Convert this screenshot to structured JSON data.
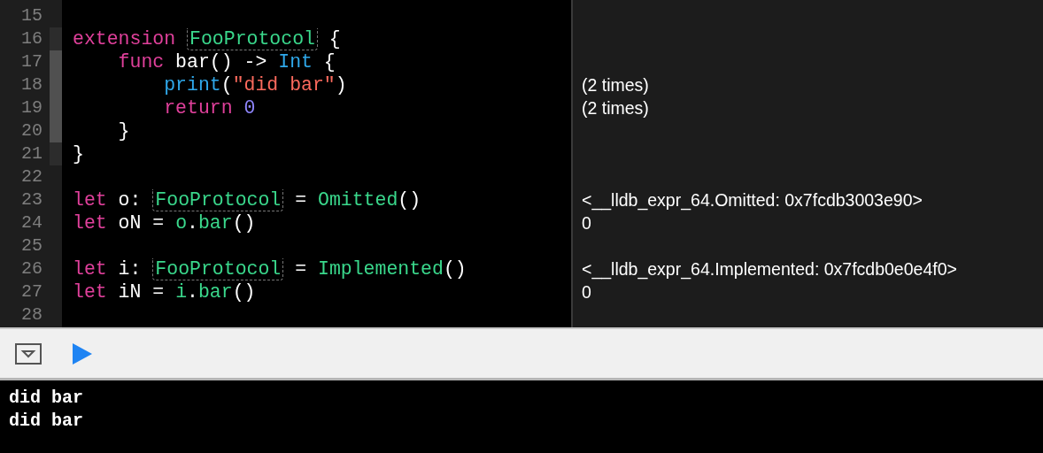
{
  "editor": {
    "lines": [
      {
        "number": "15"
      },
      {
        "number": "16",
        "ribbon": true,
        "ribbon_active": false,
        "tokens": [
          {
            "text": "extension",
            "kind": "keyword"
          },
          {
            "text": " FooProtocol",
            "kind": "protocol"
          },
          {
            "text": " {",
            "kind": "plain"
          }
        ]
      },
      {
        "number": "17",
        "ribbon": true,
        "ribbon_active": true,
        "tokens": [
          {
            "text": "    func",
            "kind": "keyword"
          },
          {
            "text": " bar() -> ",
            "kind": "plain"
          },
          {
            "text": "Int",
            "kind": "system"
          },
          {
            "text": " {",
            "kind": "plain"
          }
        ]
      },
      {
        "number": "18",
        "ribbon": true,
        "ribbon_active": true,
        "result": "(2 times)",
        "tokens": [
          {
            "text": "        print",
            "kind": "system"
          },
          {
            "text": "(",
            "kind": "plain"
          },
          {
            "text": "\"did bar\"",
            "kind": "string"
          },
          {
            "text": ")",
            "kind": "plain"
          }
        ]
      },
      {
        "number": "19",
        "ribbon": true,
        "ribbon_active": true,
        "result": "(2 times)",
        "tokens": [
          {
            "text": "        return",
            "kind": "keyword"
          },
          {
            "text": " 0",
            "kind": "number"
          }
        ]
      },
      {
        "number": "20",
        "ribbon": true,
        "ribbon_active": true,
        "tokens": [
          {
            "text": "    }",
            "kind": "plain"
          }
        ]
      },
      {
        "number": "21",
        "ribbon": true,
        "ribbon_active": false,
        "tokens": [
          {
            "text": "}",
            "kind": "plain"
          }
        ]
      },
      {
        "number": "22"
      },
      {
        "number": "23",
        "result": "<__lldb_expr_64.Omitted: 0x7fcdb3003e90>",
        "tokens": [
          {
            "text": "let",
            "kind": "keyword"
          },
          {
            "text": " o: ",
            "kind": "plain"
          },
          {
            "text": "FooProtocol",
            "kind": "protocol"
          },
          {
            "text": " = ",
            "kind": "plain"
          },
          {
            "text": "Omitted",
            "kind": "project"
          },
          {
            "text": "()",
            "kind": "plain"
          }
        ]
      },
      {
        "number": "24",
        "result": "0",
        "tokens": [
          {
            "text": "let",
            "kind": "keyword"
          },
          {
            "text": " oN = ",
            "kind": "plain"
          },
          {
            "text": "o",
            "kind": "project"
          },
          {
            "text": ".",
            "kind": "plain"
          },
          {
            "text": "bar",
            "kind": "project"
          },
          {
            "text": "()",
            "kind": "plain"
          }
        ]
      },
      {
        "number": "25"
      },
      {
        "number": "26",
        "result": "<__lldb_expr_64.Implemented: 0x7fcdb0e0e4f0>",
        "tokens": [
          {
            "text": "let",
            "kind": "keyword"
          },
          {
            "text": " i: ",
            "kind": "plain"
          },
          {
            "text": "FooProtocol",
            "kind": "protocol"
          },
          {
            "text": " = ",
            "kind": "plain"
          },
          {
            "text": "Implemented",
            "kind": "project"
          },
          {
            "text": "()",
            "kind": "plain"
          }
        ]
      },
      {
        "number": "27",
        "result": "0",
        "tokens": [
          {
            "text": "let",
            "kind": "keyword"
          },
          {
            "text": " iN = ",
            "kind": "plain"
          },
          {
            "text": "i",
            "kind": "project"
          },
          {
            "text": ".",
            "kind": "plain"
          },
          {
            "text": "bar",
            "kind": "project"
          },
          {
            "text": "()",
            "kind": "plain"
          }
        ]
      },
      {
        "number": "28"
      }
    ]
  },
  "console": {
    "lines": [
      "did bar",
      "did bar"
    ]
  }
}
